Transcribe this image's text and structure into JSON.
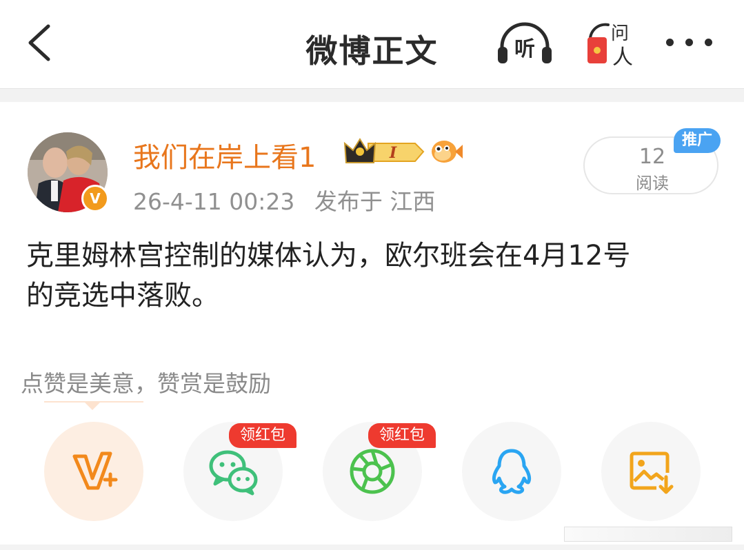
{
  "nav": {
    "title": "微博正文",
    "listen_label": "听",
    "ask_label_top": "问",
    "ask_label_bottom": "人"
  },
  "post": {
    "username": "我们在岸上看1",
    "vip_level": "I",
    "timestamp": "26-4-11 00:23",
    "published_from": "发布于 江西",
    "verified_mark": "V",
    "read_count": "12",
    "read_label": "阅读",
    "promo_label": "推广",
    "body_line_1": "克里姆林宫控制的媒体认为，欧尔班会在4月12号",
    "body_line_2": "的竞选中落败。"
  },
  "reward": {
    "hint": "点赞是美意，赞赏是鼓励"
  },
  "share": {
    "hongbao_label_1": "领红包",
    "hongbao_label_2": "领红包",
    "buttons": [
      {
        "icon": "reward-v-plus-icon"
      },
      {
        "icon": "wechat-icon"
      },
      {
        "icon": "moments-icon"
      },
      {
        "icon": "qq-icon"
      },
      {
        "icon": "save-image-icon"
      }
    ]
  },
  "colors": {
    "username": "#e8761c",
    "wechat": "#3fc07a",
    "moments": "#4cc24e",
    "qq": "#2aa5f2",
    "save": "#f2a51c",
    "reward": "#f2891c",
    "hongbao": "#ee3a2f",
    "promo": "#4aa3f2"
  }
}
